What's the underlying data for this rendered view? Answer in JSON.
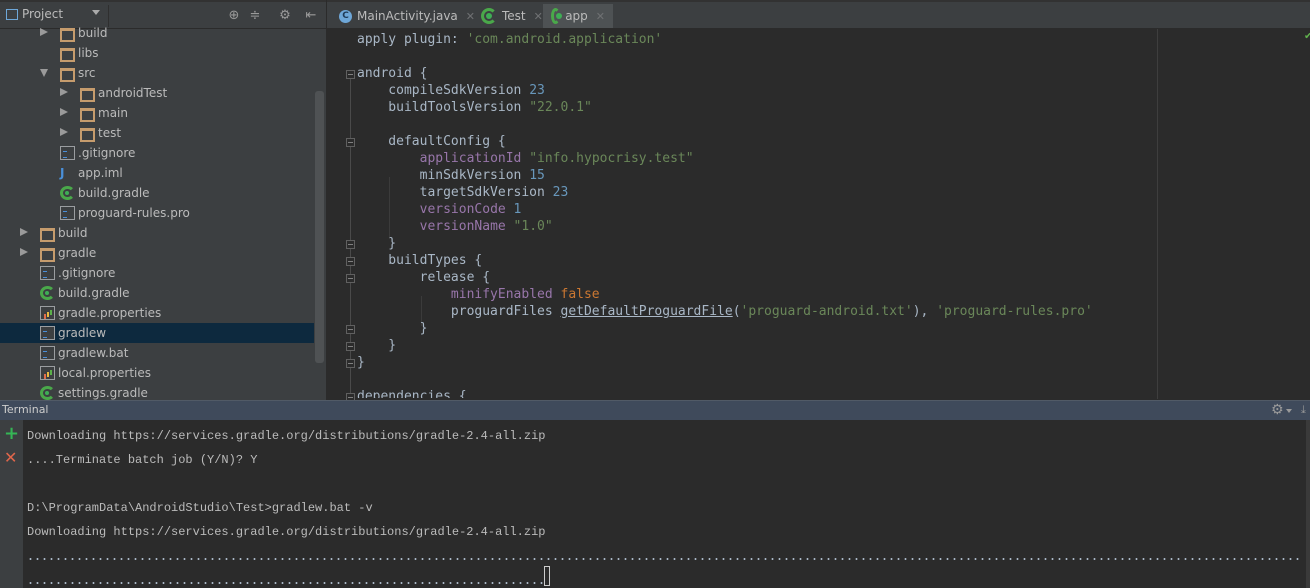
{
  "project_panel": {
    "title": "Project",
    "toolbar_icons": [
      "locate-icon",
      "collapse-all-icon",
      "settings-icon",
      "hide-panel-icon"
    ],
    "tree": [
      {
        "label": "build",
        "type": "folder",
        "depth": 2,
        "expander": "collapsed"
      },
      {
        "label": "libs",
        "type": "folder",
        "depth": 2,
        "expander": "none"
      },
      {
        "label": "src",
        "type": "folder",
        "depth": 2,
        "expander": "expanded"
      },
      {
        "label": "androidTest",
        "type": "folder",
        "depth": 3,
        "expander": "collapsed"
      },
      {
        "label": "main",
        "type": "folder",
        "depth": 3,
        "expander": "collapsed"
      },
      {
        "label": "test",
        "type": "folder",
        "depth": 3,
        "expander": "collapsed"
      },
      {
        "label": ".gitignore",
        "type": "text-file",
        "depth": 2,
        "expander": "none"
      },
      {
        "label": "app.iml",
        "type": "iml-file",
        "depth": 2,
        "expander": "none"
      },
      {
        "label": "build.gradle",
        "type": "gradle-file",
        "depth": 2,
        "expander": "none"
      },
      {
        "label": "proguard-rules.pro",
        "type": "text-file",
        "depth": 2,
        "expander": "none"
      },
      {
        "label": "build",
        "type": "folder",
        "depth": 1,
        "expander": "collapsed"
      },
      {
        "label": "gradle",
        "type": "folder",
        "depth": 1,
        "expander": "collapsed"
      },
      {
        "label": ".gitignore",
        "type": "text-file",
        "depth": 1,
        "expander": "none"
      },
      {
        "label": "build.gradle",
        "type": "gradle-file",
        "depth": 1,
        "expander": "none"
      },
      {
        "label": "gradle.properties",
        "type": "properties-file",
        "depth": 1,
        "expander": "none"
      },
      {
        "label": "gradlew",
        "type": "text-file",
        "depth": 1,
        "expander": "none",
        "selected": true
      },
      {
        "label": "gradlew.bat",
        "type": "text-file",
        "depth": 1,
        "expander": "none"
      },
      {
        "label": "local.properties",
        "type": "properties-file",
        "depth": 1,
        "expander": "none"
      },
      {
        "label": "settings.gradle",
        "type": "gradle-file",
        "depth": 1,
        "expander": "none"
      }
    ]
  },
  "editor": {
    "tabs": [
      {
        "label": "MainActivity.java",
        "icon": "java-class-icon",
        "active": false
      },
      {
        "label": "Test",
        "icon": "gradle-icon",
        "active": false
      },
      {
        "label": "app",
        "icon": "gradle-icon",
        "active": true
      }
    ],
    "code_lines": [
      [
        {
          "t": "apply plugin: ",
          "c": ""
        },
        {
          "t": "'com.android.application'",
          "c": "str"
        }
      ],
      [],
      [
        {
          "t": "android {",
          "c": ""
        }
      ],
      [
        {
          "t": "    compileSdkVersion ",
          "c": ""
        },
        {
          "t": "23",
          "c": "num"
        }
      ],
      [
        {
          "t": "    buildToolsVersion ",
          "c": ""
        },
        {
          "t": "\"22.0.1\"",
          "c": "str"
        }
      ],
      [],
      [
        {
          "t": "    defaultConfig {",
          "c": ""
        }
      ],
      [
        {
          "t": "        ",
          "c": ""
        },
        {
          "t": "applicationId",
          "c": "kw-p"
        },
        {
          "t": " ",
          "c": ""
        },
        {
          "t": "\"info.hypocrisy.test\"",
          "c": "str"
        }
      ],
      [
        {
          "t": "        minSdkVersion ",
          "c": ""
        },
        {
          "t": "15",
          "c": "num"
        }
      ],
      [
        {
          "t": "        targetSdkVersion ",
          "c": ""
        },
        {
          "t": "23",
          "c": "num"
        }
      ],
      [
        {
          "t": "        ",
          "c": ""
        },
        {
          "t": "versionCode",
          "c": "kw-p"
        },
        {
          "t": " ",
          "c": ""
        },
        {
          "t": "1",
          "c": "num"
        }
      ],
      [
        {
          "t": "        ",
          "c": ""
        },
        {
          "t": "versionName",
          "c": "kw-p"
        },
        {
          "t": " ",
          "c": ""
        },
        {
          "t": "\"1.0\"",
          "c": "str"
        }
      ],
      [
        {
          "t": "    }",
          "c": ""
        }
      ],
      [
        {
          "t": "    buildTypes {",
          "c": ""
        }
      ],
      [
        {
          "t": "        release {",
          "c": ""
        }
      ],
      [
        {
          "t": "            ",
          "c": ""
        },
        {
          "t": "minifyEnabled",
          "c": "kw-p"
        },
        {
          "t": " ",
          "c": ""
        },
        {
          "t": "false",
          "c": "kw-o"
        }
      ],
      [
        {
          "t": "            proguardFiles ",
          "c": ""
        },
        {
          "t": "getDefaultProguardFile",
          "c": "fn"
        },
        {
          "t": "(",
          "c": ""
        },
        {
          "t": "'proguard-android.txt'",
          "c": "str"
        },
        {
          "t": "), ",
          "c": ""
        },
        {
          "t": "'proguard-rules.pro'",
          "c": "str"
        }
      ],
      [
        {
          "t": "        }",
          "c": ""
        }
      ],
      [
        {
          "t": "    }",
          "c": ""
        }
      ],
      [
        {
          "t": "}",
          "c": ""
        }
      ],
      [],
      [
        {
          "t": "dependencies {",
          "c": ""
        }
      ]
    ]
  },
  "terminal": {
    "title": "Terminal",
    "lines": [
      "Downloading https://services.gradle.org/distributions/gradle-2.4-all.zip",
      "....Terminate batch job (Y/N)? Y",
      "",
      "D:\\ProgramData\\AndroidStudio\\Test>gradlew.bat -v",
      "Downloading https://services.gradle.org/distributions/gradle-2.4-all.zip"
    ],
    "progress_dots_lines": 2
  }
}
